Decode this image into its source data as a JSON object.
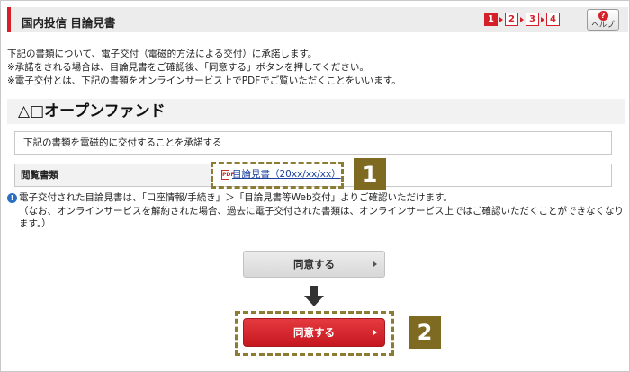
{
  "header": {
    "title": "国内投信 目論見書",
    "steps": [
      "1",
      "2",
      "3",
      "4"
    ],
    "active_step": "1",
    "help_label": "ヘルプ",
    "help_icon_glyph": "?"
  },
  "intro": [
    "下記の書類について、電子交付（電磁的方法による交付）に承諾します。",
    "※承諾をされる場合は、目論見書をご確認後、「同意する」ボタンを押してください。",
    "※電子交付とは、下記の書類をオンラインサービス上でPDFでご覧いただくことをいいます。"
  ],
  "fund_name": "△□オープンファンド",
  "consent_text": "下記の書類を電磁的に交付することを承諾する",
  "documents": {
    "label": "閲覧書類",
    "link_text": "目論見書（20xx/xx/xx）",
    "icon": "pdf-icon"
  },
  "note": {
    "icon": "info-icon",
    "main": "電子交付された目論見書は、「口座情報/手続き」＞「目論見書等Web交付」よりご確認いただけます。",
    "sub": "（なお、オンラインサービスを解約された場合、過去に電子交付された書類は、オンラインサービス上ではご確認いただくことができなくなります。）"
  },
  "buttons": {
    "agree_disabled_label": "同意する",
    "agree_enabled_label": "同意する"
  },
  "annotations": {
    "badge_1": "1",
    "badge_2": "2"
  },
  "colors": {
    "accent_red": "#d5202a",
    "highlight_dash": "#8c7b32",
    "badge_bg": "#7f6a22",
    "link_blue": "#1a3f9e"
  }
}
